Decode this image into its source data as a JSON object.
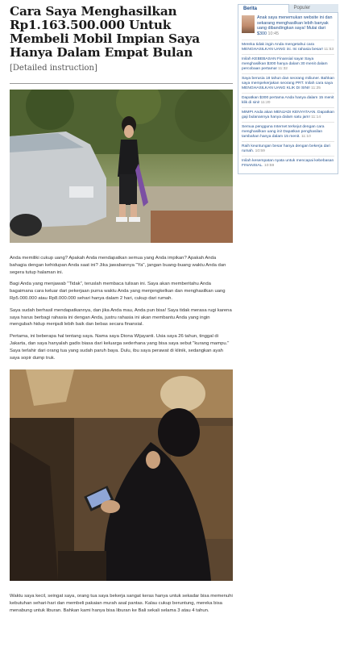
{
  "article": {
    "title": "Cara Saya Menghasilkan Rp1.163.500.000 Untuk Membeli Mobil Impian Saya Hanya Dalam Empat Bulan",
    "subtitle": "[Detailed instruction]",
    "paragraphs_before": [
      "Anda memiliki cukup uang? Apakah Anda mendapatkan semua yang Anda impikan? Apakah Anda bahagia dengan kehidupan Anda saat ini? Jika jawabannya \"Ya\", jangan buang-buang waktu Anda dan segera tutup halaman ini.",
      "Bagi Anda yang menjawab \"Tidak\", teruslah membaca tulisan ini. Saya akan memberitahu Anda bagaimana cara keluar dari pekerjaan purna waktu Anda yang menjengkelkan dan menghasilkan uang Rp5.000.000 atau Rp8.000.000 sehari hanya dalam 2 hari, cukup dari rumah.",
      "Saya sudah berhasil mendapatkannya, dan jika Anda mau, Anda pun bisa! Saya tidak merasa rugi karena saya harus berbagi rahasia ini dengan Anda, justru rahasia ini akan membantu Anda yang ingin mengubah hidup menjadi lebih baik dan bebas secara finansial.",
      "Pertama, ini beberapa hal tentang saya. Nama saya Diona Wijayanti. Usia saya 26 tahun, tinggal di Jakarta, dan saya hanyalah gadis biasa dari keluarga sederhana yang bisa saya sebut \"kurang mampu.\" Saya terlahir dari orang tua yang sudah paruh baya. Dulu, ibu saya perawat di klinik, sedangkan ayah saya sopir dump truk."
    ],
    "paragraph_after": "Waktu saya kecil, seingat saya, orang tua saya bekerja sangat keras hanya untuk sekadar bisa memenuhi kebutuhan sehari-hari dan membeli pakaian murah asal pantas. Kalau cukup beruntung, mereka bisa menabung untuk liburan. Bahkan kami hanya bisa liburan ke Bali sekali selama 3 atau 4 tahun."
  },
  "sidebar": {
    "tab_active": "Berita",
    "tab_inactive": "Populer",
    "featured_text": "Anak saya menemukan website ini dan sekarang menghasilkan lebih banyak uang dibandingkan saya! Mulai dari $300",
    "featured_time": "10:45",
    "items": [
      {
        "text": "Mereka tidak ingin Anda mengetahui cara MENGHASILKAN UANG ini. Ini rahasia besar!",
        "time": "11:53"
      },
      {
        "text": "Inilah KEBEBASAN Finansial saya! Saya menghasilkan $300 hanya dalam 30 menit dalam percobaan pertama!",
        "time": "11:32"
      },
      {
        "text": "Saya berusia 18 tahun dan seorang miliuner. Bahkan saya mempekerjakan seorang PRT. Inilah cara saya MENGHASILKAN UANG KLIK DI SINI!",
        "time": "11:25"
      },
      {
        "text": "Dapatkan $300 pertama Anda hanya dalam 15 menit klik di sini!",
        "time": "11:20"
      },
      {
        "text": "MIMPI Anda akan MENJADI KENYATAAN. Dapatkan gaji bulanannya hanya dalam satu jam!",
        "time": "11:14"
      },
      {
        "text": "Semua pengguna Internet terkejut dengan cara menghasilkan uang ini! Dapatkan penghasilan tambahan hanya dalam 15 menit.",
        "time": "11:10"
      },
      {
        "text": "Raih keuntungan besar hanya dengan bekerja dari rumah.",
        "time": "10:59"
      },
      {
        "text": "Inilah kesempatan nyata untuk mencapai kebebasan FINANSIAL.",
        "time": "10:59"
      }
    ]
  }
}
